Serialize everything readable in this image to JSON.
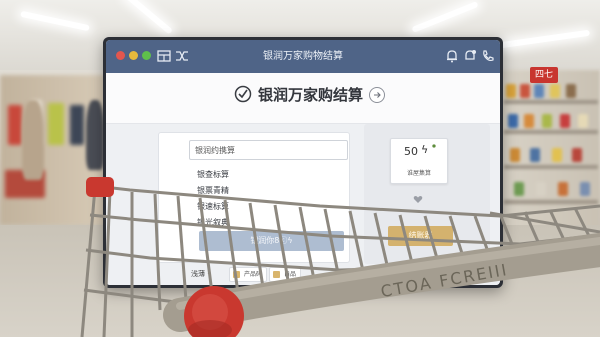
{
  "window": {
    "title": "银润万家购物结算"
  },
  "header": {
    "title": "银润万家购结算"
  },
  "search": {
    "value": "银润约携算"
  },
  "list": {
    "items": [
      "银查标算",
      "银票青精",
      "银速标算",
      "银光叙典"
    ]
  },
  "buttons": {
    "primary_label": "银润你8ⓒϟ",
    "secondary_label": "结账器"
  },
  "receipt": {
    "amount": "50",
    "mark": "ϟ",
    "subtitle": "谁屋集算"
  },
  "footer": {
    "label": "浅薄",
    "label_suffix": "ϟ",
    "chip1": "产品码",
    "chip2": "自品"
  },
  "store_sign": "四七",
  "cart_handle_text": "CTOA FCREIII",
  "colors": {
    "titlebar": "#4f6487",
    "primary_button": "#aebdd1",
    "secondary_button": "#d4b26e",
    "cart_handle": "#9a9386",
    "cart_red": "#c9382f"
  },
  "icons": {
    "titlebar_left": [
      "app-grid-icon",
      "shuffle-icon"
    ],
    "titlebar_right": [
      "bell-icon",
      "notification-icon",
      "phone-icon"
    ],
    "header": [
      "check-circle-icon",
      "arrow-forward-icon"
    ],
    "receipt": "lightning-icon",
    "panel": "heart-icon"
  }
}
